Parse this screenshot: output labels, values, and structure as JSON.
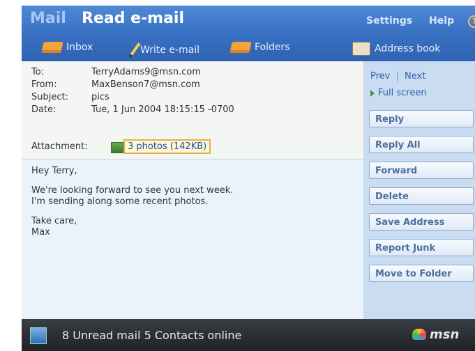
{
  "header": {
    "app_title": "Mail",
    "page_title": "Read e-mail",
    "settings_label": "Settings",
    "help_label": "Help",
    "help_glyph": "?"
  },
  "nav": {
    "inbox_label": "Inbox",
    "write_label": "Write e-mail",
    "folders_label": "Folders",
    "address_book_label": "Address book"
  },
  "email": {
    "to_label": "To:",
    "to": "TerryAdams9@msn.com",
    "from_label": "From:",
    "from": "MaxBenson7@msn.com",
    "subject_label": "Subject:",
    "subject": "pics",
    "date_label": "Date:",
    "date": "Tue, 1 Jun 2004 18:15:15 -0700",
    "attachment_label": "Attachment:",
    "attachment_link": "3 photos (142KB)",
    "body": {
      "greeting": "Hey Terry,",
      "line1": "We're looking forward to see you next week.",
      "line2": "I'm sending along some recent photos.",
      "signoff": "Take care,",
      "signature": "Max"
    }
  },
  "side": {
    "prev_label": "Prev",
    "separator": "|",
    "next_label": "Next",
    "fullscreen_label": "Full screen",
    "actions": [
      "Reply",
      "Reply All",
      "Forward",
      "Delete",
      "Save Address",
      "Report Junk",
      "Move to Folder"
    ]
  },
  "status": {
    "text": "8 Unread mail  5 Contacts online",
    "brand": "msn"
  },
  "colors": {
    "header_blue": "#3b73c4",
    "side_panel": "#c9dcf1",
    "link_blue": "#1f4fa5",
    "status_bar": "#2a2e33",
    "attachment_highlight": "#e2b34a"
  }
}
